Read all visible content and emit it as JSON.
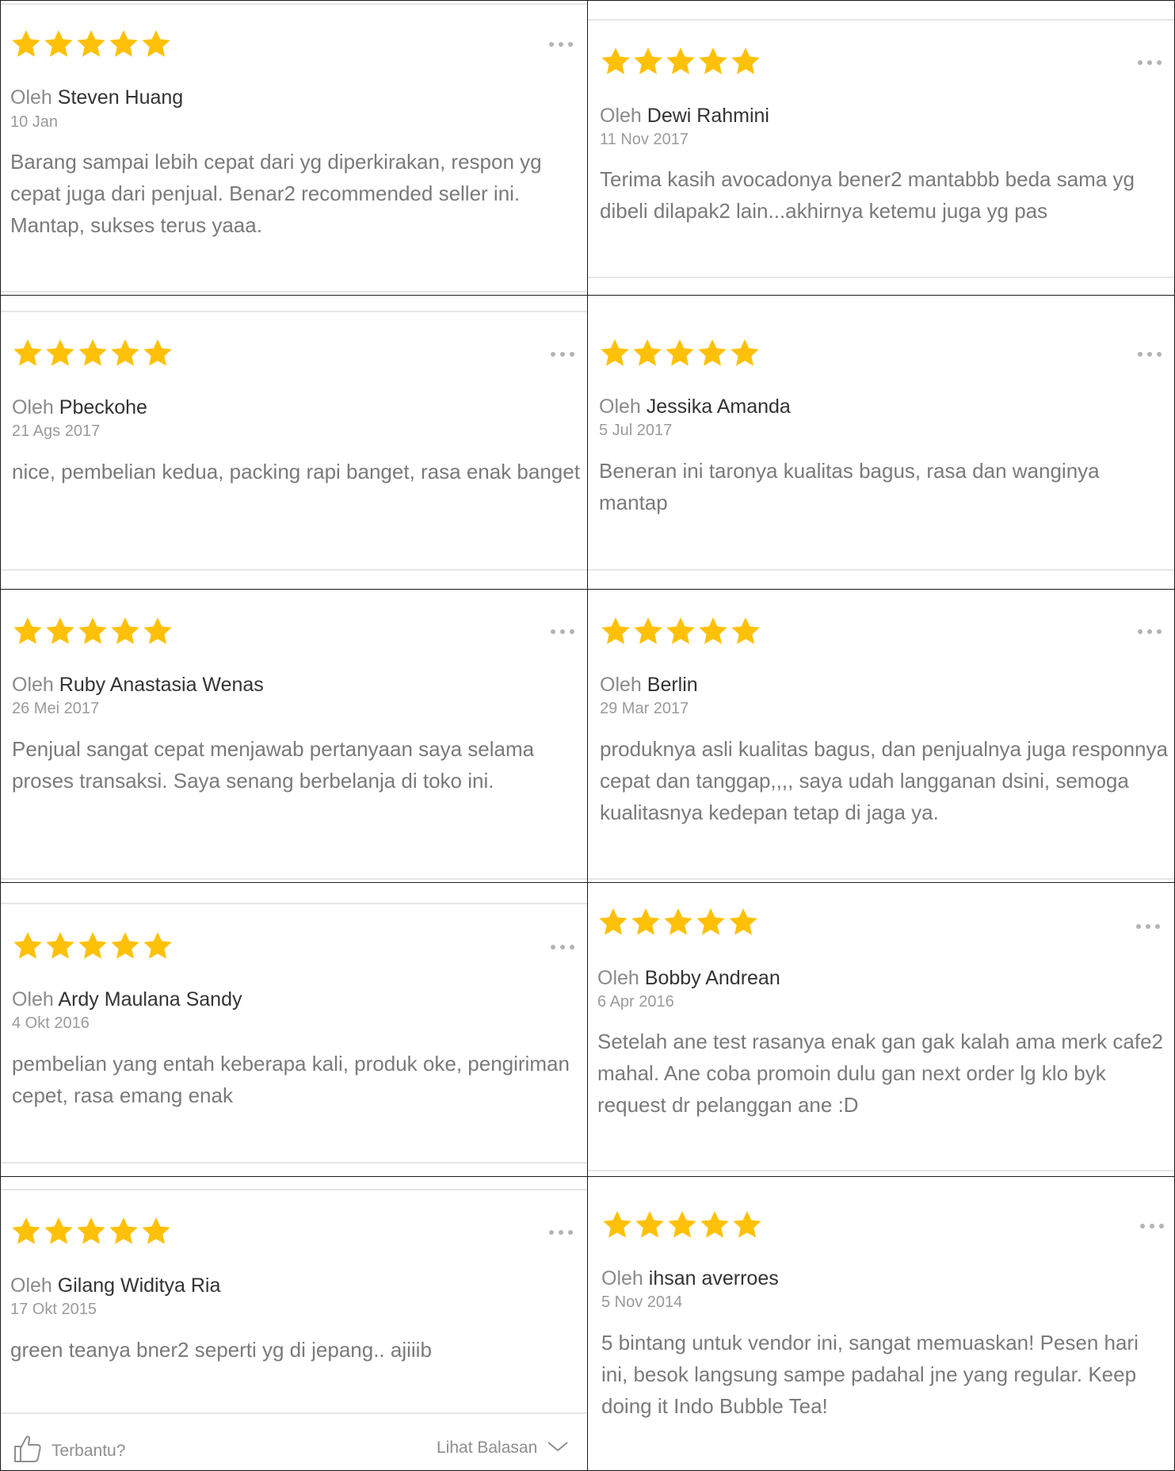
{
  "star_color": "#FFC107",
  "rating_max": 5,
  "author_prefix": "Oleh",
  "reviews": [
    {
      "rating": 5,
      "author": "Steven Huang",
      "date": "10 Jan",
      "text": "Barang sampai lebih cepat dari yg diperkirakan, respon yg cepat juga dari penjual. Benar2 recommended seller ini. Mantap, sukses terus yaaa."
    },
    {
      "rating": 5,
      "author": "Dewi Rahmini",
      "date": "11 Nov 2017",
      "text": "Terima kasih avocadonya bener2 mantabbb beda sama yg dibeli dilapak2 lain...akhirnya ketemu juga yg pas"
    },
    {
      "rating": 5,
      "author": "Pbeckohe",
      "date": "21 Ags 2017",
      "text": "nice, pembelian kedua, packing rapi banget, rasa enak banget"
    },
    {
      "rating": 5,
      "author": "Jessika Amanda",
      "date": "5 Jul 2017",
      "text": "Beneran ini taronya kualitas bagus, rasa dan wanginya mantap"
    },
    {
      "rating": 5,
      "author": "Ruby Anastasia Wenas",
      "date": "26 Mei 2017",
      "text": "Penjual sangat cepat menjawab pertanyaan saya selama proses transaksi. Saya senang berbelanja di toko ini."
    },
    {
      "rating": 5,
      "author": "Berlin",
      "date": "29 Mar 2017",
      "text": "produknya asli kualitas bagus, dan penjualnya juga responnya cepat dan tanggap,,,, saya udah langganan dsini, semoga kualitasnya kedepan tetap di jaga ya."
    },
    {
      "rating": 5,
      "author": "Ardy Maulana Sandy",
      "date": "4 Okt 2016",
      "text": "pembelian yang entah keberapa kali, produk oke, pengiriman cepet, rasa emang enak"
    },
    {
      "rating": 5,
      "author": "Bobby Andrean",
      "date": "6 Apr 2016",
      "text": "Setelah ane test rasanya enak gan gak kalah ama merk cafe2 mahal.  Ane coba promoin dulu gan next order lg klo byk request dr pelanggan ane :D"
    },
    {
      "rating": 5,
      "author": "Gilang Widitya Ria",
      "date": "17 Okt 2015",
      "text": "green teanya bner2 seperti yg di jepang.. ajiiib",
      "footer": {
        "helpful_label": "Terbantu?",
        "replies_label": "Lihat Balasan"
      }
    },
    {
      "rating": 5,
      "author": "ihsan averroes",
      "date": "5 Nov 2014",
      "text": "5 bintang untuk vendor ini, sangat memuaskan! Pesen hari ini, besok langsung sampe padahal jne yang regular. Keep doing it Indo Bubble Tea!"
    }
  ]
}
